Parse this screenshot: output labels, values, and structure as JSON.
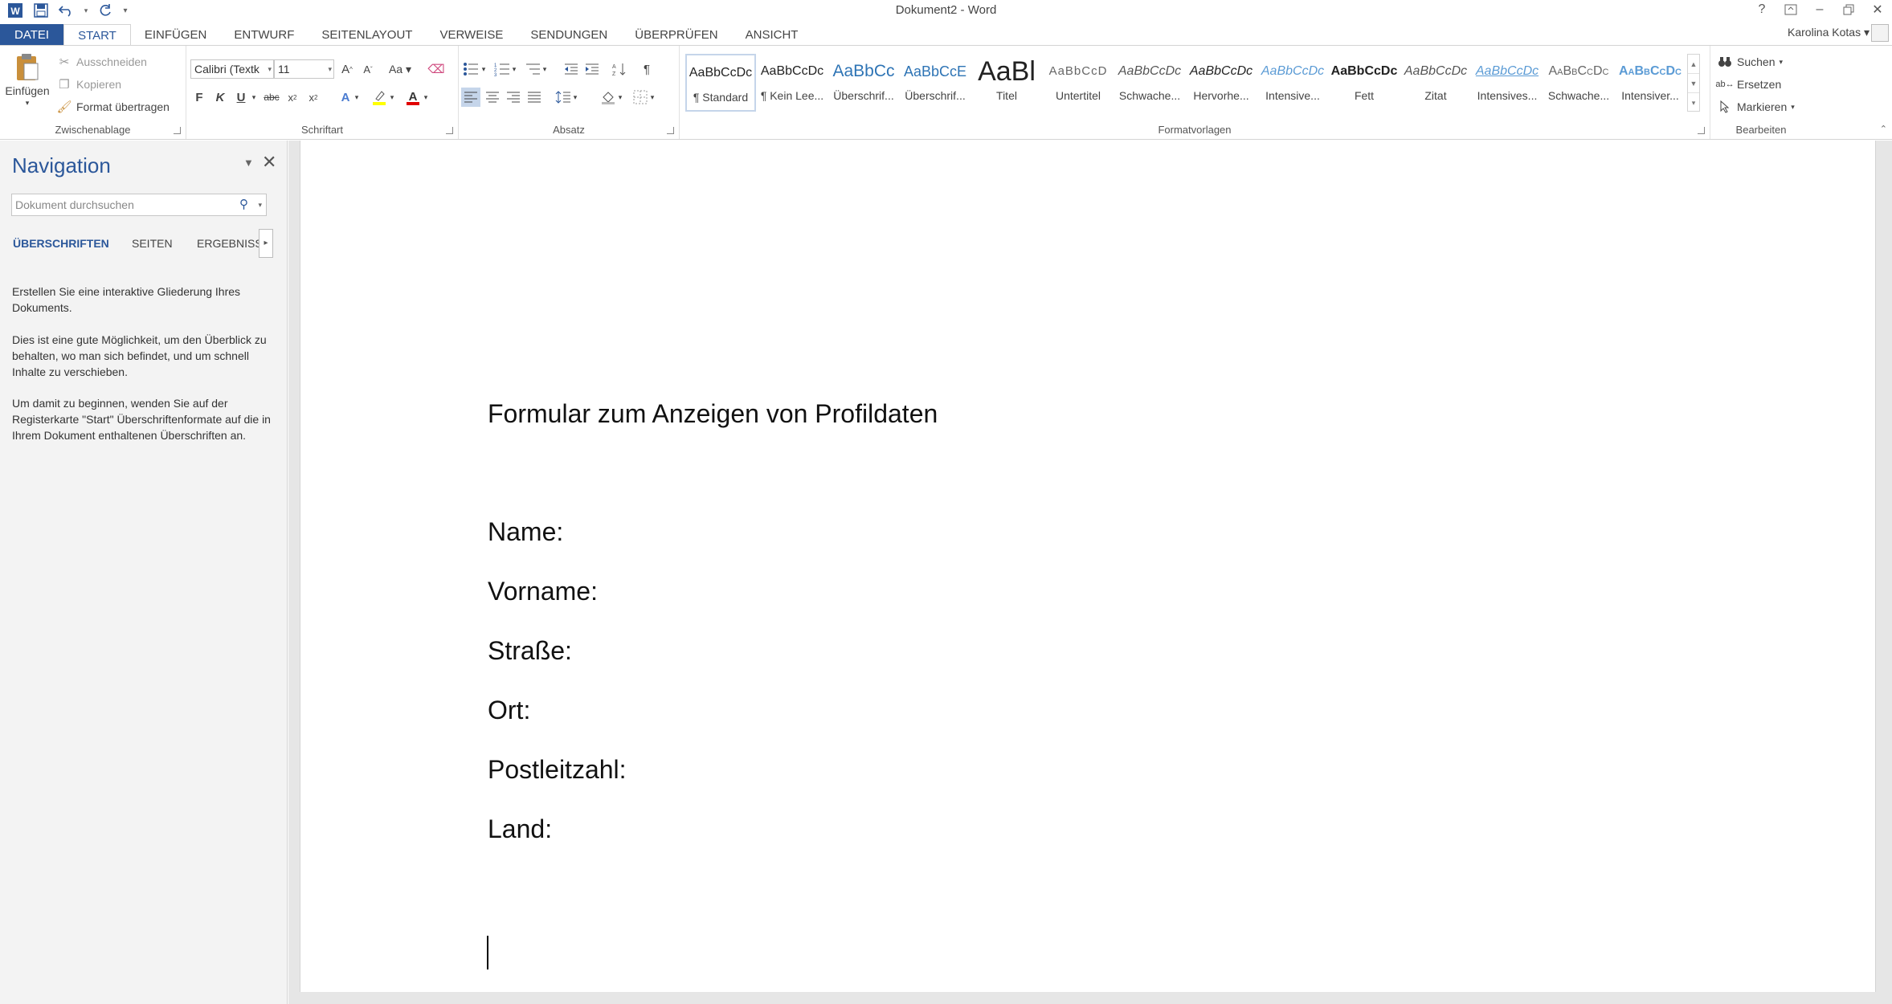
{
  "window": {
    "title": "Dokument2 - Word",
    "user": "Karolina Kotas"
  },
  "tabs": [
    "DATEI",
    "START",
    "EINFÜGEN",
    "ENTWURF",
    "SEITENLAYOUT",
    "VERWEISE",
    "SENDUNGEN",
    "ÜBERPRÜFEN",
    "ANSICHT"
  ],
  "ribbon": {
    "clipboard": {
      "label": "Zwischenablage",
      "paste": "Einfügen",
      "cut": "Ausschneiden",
      "copy": "Kopieren",
      "format_painter": "Format übertragen"
    },
    "font": {
      "label": "Schriftart",
      "family": "Calibri (Textk",
      "size": "11",
      "bold": "F",
      "italic": "K",
      "underline": "U"
    },
    "paragraph": {
      "label": "Absatz"
    },
    "styles": {
      "label": "Formatvorlagen",
      "items": [
        {
          "preview": "AaBbCcDc",
          "name": "¶ Standard"
        },
        {
          "preview": "AaBbCcDc",
          "name": "¶ Kein Lee..."
        },
        {
          "preview": "AaBbCc",
          "name": "Überschrif..."
        },
        {
          "preview": "AaBbCcE",
          "name": "Überschrif..."
        },
        {
          "preview": "AaBl",
          "name": "Titel"
        },
        {
          "preview": "AaBbCcD",
          "name": "Untertitel"
        },
        {
          "preview": "AaBbCcDc",
          "name": "Schwache..."
        },
        {
          "preview": "AaBbCcDc",
          "name": "Hervorhe..."
        },
        {
          "preview": "AaBbCcDc",
          "name": "Intensive..."
        },
        {
          "preview": "AaBbCcDc",
          "name": "Fett"
        },
        {
          "preview": "AaBbCcDc",
          "name": "Zitat"
        },
        {
          "preview": "AaBbCcDc",
          "name": "Intensives..."
        },
        {
          "preview": "AaBbCcDc",
          "name": "Schwache..."
        },
        {
          "preview": "AaBbCcDc",
          "name": "Intensiver..."
        }
      ]
    },
    "editing": {
      "label": "Bearbeiten",
      "find": "Suchen",
      "replace": "Ersetzen",
      "select": "Markieren"
    }
  },
  "navigation": {
    "title": "Navigation",
    "search_placeholder": "Dokument durchsuchen",
    "tabs": [
      "ÜBERSCHRIFTEN",
      "SEITEN",
      "ERGEBNISSE"
    ],
    "paragraphs": [
      "Erstellen Sie eine interaktive Gliederung Ihres Dokuments.",
      "Dies ist eine gute Möglichkeit, um den Überblick zu behalten, wo man sich befindet, und um schnell Inhalte zu verschieben.",
      "Um damit zu beginnen, wenden Sie auf der Registerkarte \"Start\" Überschriftenformate auf die in Ihrem Dokument enthaltenen Überschriften an."
    ]
  },
  "document": {
    "title": "Formular zum Anzeigen von Profildaten",
    "fields": [
      "Name:",
      "Vorname:",
      "Straße:",
      "Ort:",
      "Postleitzahl:",
      "Land:"
    ]
  },
  "colors": {
    "accent": "#2b579a",
    "nav_bg": "#f3f3f3"
  }
}
